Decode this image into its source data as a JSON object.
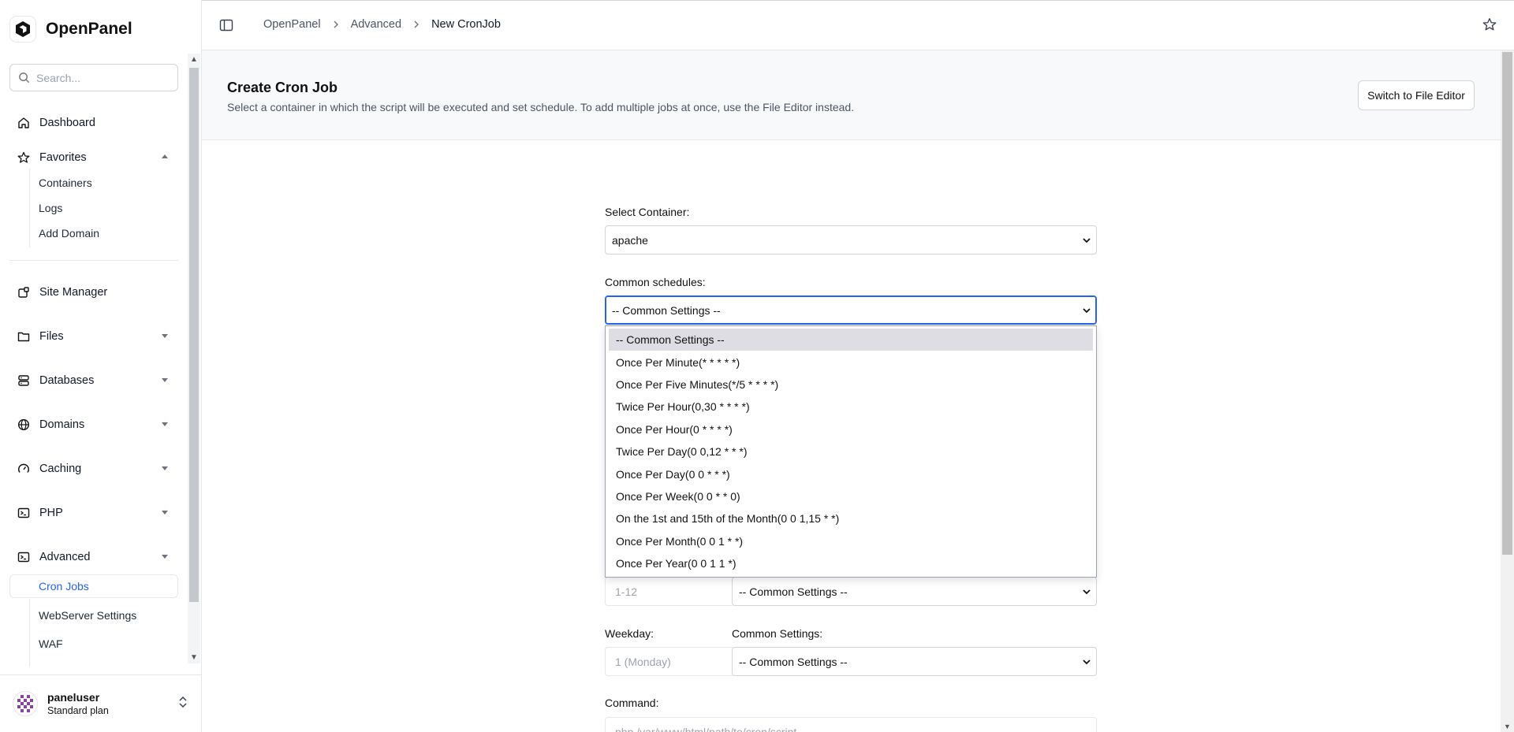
{
  "app": {
    "name": "OpenPanel"
  },
  "search": {
    "placeholder": "Search..."
  },
  "sidebar": {
    "dashboard": "Dashboard",
    "favorites": "Favorites",
    "favorites_items": [
      "Containers",
      "Logs",
      "Add Domain"
    ],
    "site_manager": "Site Manager",
    "files": "Files",
    "databases": "Databases",
    "domains": "Domains",
    "caching": "Caching",
    "php": "PHP",
    "advanced": "Advanced",
    "advanced_items": [
      "Cron Jobs",
      "WebServer Settings",
      "WAF"
    ]
  },
  "user": {
    "name": "paneluser",
    "plan": "Standard plan"
  },
  "breadcrumb": [
    "OpenPanel",
    "Advanced",
    "New CronJob"
  ],
  "page": {
    "title": "Create Cron Job",
    "description": "Select a container in which the script will be executed and set schedule. To add multiple jobs at once, use the File Editor instead.",
    "switch_button": "Switch to File Editor"
  },
  "form": {
    "container_label": "Select Container:",
    "container_value": "apache",
    "common_schedules_label": "Common schedules:",
    "common_schedules_value": "-- Common Settings --",
    "month_placeholder": "1-12",
    "month_common_value": "-- Common Settings --",
    "weekday_label": "Weekday:",
    "weekday_common_label": "Common Settings:",
    "weekday_placeholder": "1 (Monday)",
    "weekday_common_value": "-- Common Settings --",
    "command_label": "Command:",
    "command_placeholder": "php /var/www/html/path/to/cron/script"
  },
  "dropdown_options": [
    "-- Common Settings --",
    "Once Per Minute(* * * * *)",
    "Once Per Five Minutes(*/5 * * * *)",
    "Twice Per Hour(0,30 * * * *)",
    "Once Per Hour(0 * * * *)",
    "Twice Per Day(0 0,12 * * *)",
    "Once Per Day(0 0 * * *)",
    "Once Per Week(0 0 * * 0)",
    "On the 1st and 15th of the Month(0 0 1,15 * *)",
    "Once Per Month(0 0 1 * *)",
    "Once Per Year(0 0 1 1 *)"
  ],
  "colors": {
    "accent": "#2563eb",
    "selected_option": "#dedde3"
  }
}
